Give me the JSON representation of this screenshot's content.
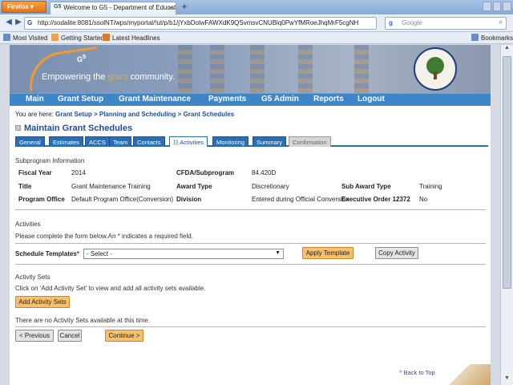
{
  "browser": {
    "app_button": "Firefox",
    "tab_title": "Welcome to G5 - Department of Educati...",
    "url": "http://sodalite:8081/ssolNT/wps/myportal/!ut/p/b1/jYxbDolwFAWXdK9QSvmsvCNUBlq0PwYfMRoeJhqMrF5cgNH",
    "search_placeholder": "Google",
    "bookmarks": [
      "Most Visited",
      "Getting Started",
      "Latest Headlines"
    ],
    "bookmarks_menu": "Bookmarks"
  },
  "banner": {
    "logo": "G",
    "logo_sup": "5",
    "tagline_pre": "Empowering the ",
    "tagline_accent": "grant",
    "tagline_post": " community."
  },
  "menu": [
    "Main",
    "Grant Setup",
    "Grant Maintenance",
    "Payments",
    "G5 Admin",
    "Reports",
    "Logout"
  ],
  "breadcrumb": {
    "prefix": "You are here: ",
    "items": [
      "Grant Setup",
      "Planning and Scheduling",
      "Grant Schedules"
    ],
    "sep": " > "
  },
  "page_title": "Maintain Grant Schedules",
  "tabs": [
    "General",
    "Estimates",
    "ACCS",
    "Team",
    "Contacts",
    "Activities",
    "Monitoring",
    "Summary",
    "Confirmation"
  ],
  "subprogram": {
    "heading": "Subprogram Information",
    "fiscal_year_label": "Fiscal Year",
    "fiscal_year": "2014",
    "cfda_label": "CFDA/Subprogram",
    "cfda": "84.420D",
    "title_label": "Title",
    "title": "Grant Maintenance Training",
    "award_type_label": "Award Type",
    "award_type": "Discretionary",
    "sub_award_type_label": "Sub Award Type",
    "sub_award_type": "Training",
    "program_office_label": "Program Office",
    "program_office": "Default Program Office(Conversion)",
    "division_label": "Division",
    "division": "Entered during Official Conversion",
    "exec_order_label": "Executive Order 12372",
    "exec_order": "No"
  },
  "activities": {
    "heading": "Activities",
    "instr_pre": "Please complete the form below.An ",
    "instr_star": "*",
    "instr_post": " indicates a required field.",
    "schedule_label": "Schedule Templates",
    "schedule_star": "*",
    "select_value": "- Select -",
    "apply_button": "Apply Template",
    "copy_button": "Copy Activity"
  },
  "activity_sets": {
    "heading": "Activity Sets",
    "instr": "Click on 'Add Activity Set' to view and add all activity sets available.",
    "add_button": "Add Activity Sets",
    "empty": "There are no Activity Sets available at this time."
  },
  "footer": {
    "previous": "< Previous",
    "cancel": "Cancel",
    "continue": "Continue >",
    "back_to_top": "^ Back to Top"
  }
}
